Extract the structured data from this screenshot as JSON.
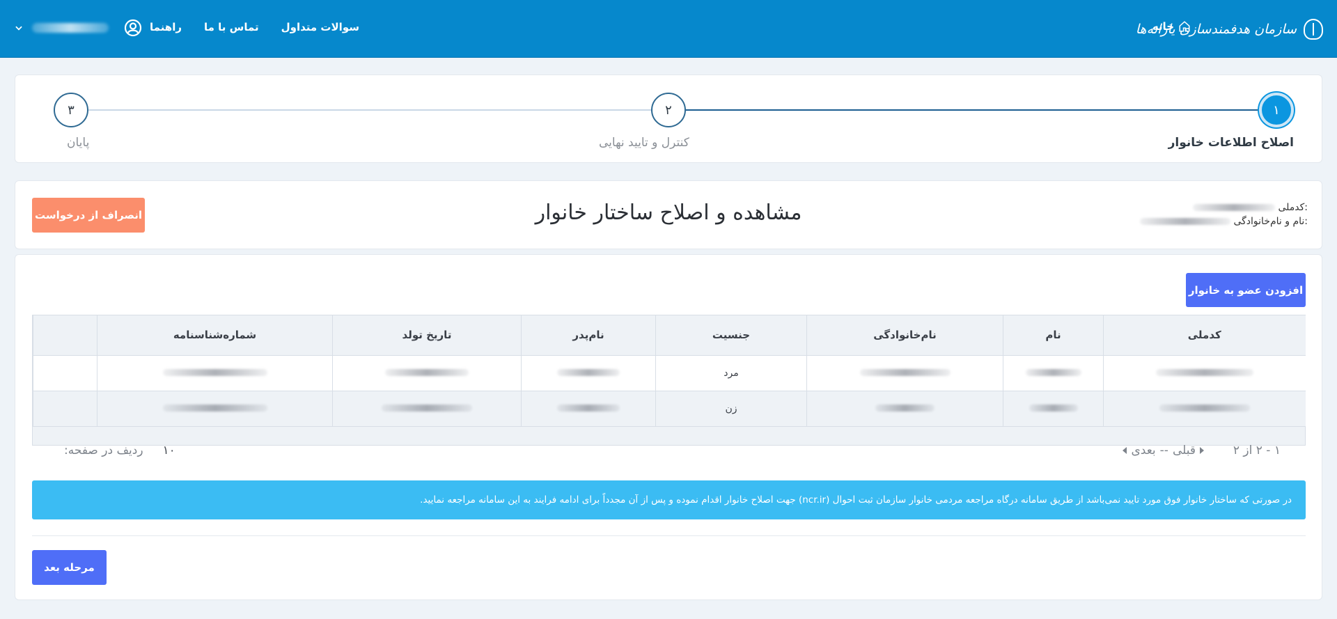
{
  "header": {
    "brand_name": "سازمان هدفمندسازی یارانه‌ها",
    "home_label": "خانه",
    "nav": [
      "سوالات متداول",
      "تماس با ما",
      "راهنما"
    ]
  },
  "stepper": {
    "steps": [
      {
        "number": "۱",
        "label": "اصلاح اطلاعات خانوار"
      },
      {
        "number": "۲",
        "label": "کنترل و تایید نهایی"
      },
      {
        "number": "۳",
        "label": "پایان"
      }
    ]
  },
  "title_section": {
    "national_code_label": "کدملی:",
    "full_name_label": "نام و نام‌خانوادگی:",
    "title": "مشاهده و اصلاح ساختار خانوار",
    "cancel_label": "انصراف از درخواست"
  },
  "main": {
    "add_member_label": "افزودن عضو به خانوار",
    "table": {
      "headers": [
        "کدملی",
        "نام",
        "نام‌خانوادگی",
        "جنسیت",
        "نام‌پدر",
        "تاریخ تولد",
        "شماره‌شناسنامه",
        ""
      ],
      "rows": [
        {
          "gender": "مرد"
        },
        {
          "gender": "زن"
        }
      ]
    },
    "pager": {
      "range": "۱ - ۲ از ۲",
      "prev_label": "قبلی",
      "separator": "--",
      "next_label": "بعدی",
      "rows_per_page_label": "ردیف در صفحه:",
      "rows_per_page_value": "۱۰"
    },
    "notice": "در صورتی که ساختار خانوار فوق مورد تایید نمی‌باشد از طریق سامانه درگاه مراجعه مردمی خانوار سازمان ثبت احوال (ncr.ir) جهت اصلاح خانوار اقدام نموده و پس از آن مجدداً برای ادامه فرایند به این سامانه مراجعه نمایید.",
    "next_step_label": "مرحله بعد"
  },
  "colors": {
    "header_bg": "#0688cc",
    "primary_button": "#4f6ef7",
    "cancel_button": "#fb8e6c",
    "notice_bg": "#3bbcf3",
    "step_active": "#0b96e0"
  }
}
